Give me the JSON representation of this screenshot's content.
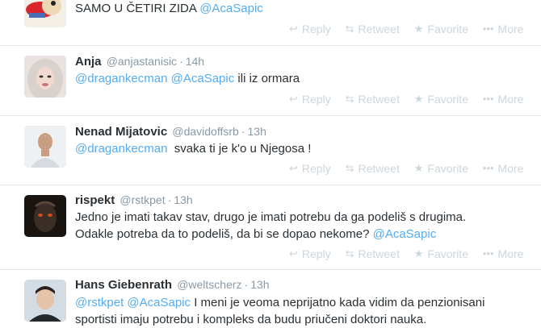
{
  "actions": {
    "reply": "Reply",
    "retweet": "Retweet",
    "favorite": "Favorite",
    "more": "More"
  },
  "colors": {
    "mention": "#55acee",
    "action": "#ccd6dd",
    "meta": "#8899a6",
    "text": "#292f33",
    "divider": "#e1e8ed"
  },
  "tweets": [
    {
      "text_before": "SAMO U ČETIRI ZIDA ",
      "mention1": "@AcaSapic"
    },
    {
      "name": "Anja",
      "handle": "@anjastanisic",
      "sep": "·",
      "time": "14h",
      "mention1": "@dragankecman",
      "mention2": "@AcaSapic",
      "text_after": " ili iz ormara"
    },
    {
      "name": "Nenad Mijatovic",
      "handle": "@davidoffsrb",
      "sep": "·",
      "time": "13h",
      "mention1": "@dragankecman",
      "text_after": "  svaka ti je k'o u Njegosa !"
    },
    {
      "name": "rispekt",
      "handle": "@rstkpet",
      "sep": "·",
      "time": "13h",
      "text_before": "Jedno je imati takav stav, drugo je imati potrebu da ga podeliš s drugima. Odakle potreba da to podeliš, da bi se dopao nekome? ",
      "mention1": "@AcaSapic"
    },
    {
      "name": "Hans Giebenrath",
      "handle": "@weltscherz",
      "sep": "·",
      "time": "13h",
      "mention1": "@rstkpet",
      "mention2": "@AcaSapic",
      "text_after": " I meni je veoma neprijatno kada vidim da penzionisani sportisti imaju potrebu i kompleks da budu priučeni doktori nauka."
    }
  ]
}
